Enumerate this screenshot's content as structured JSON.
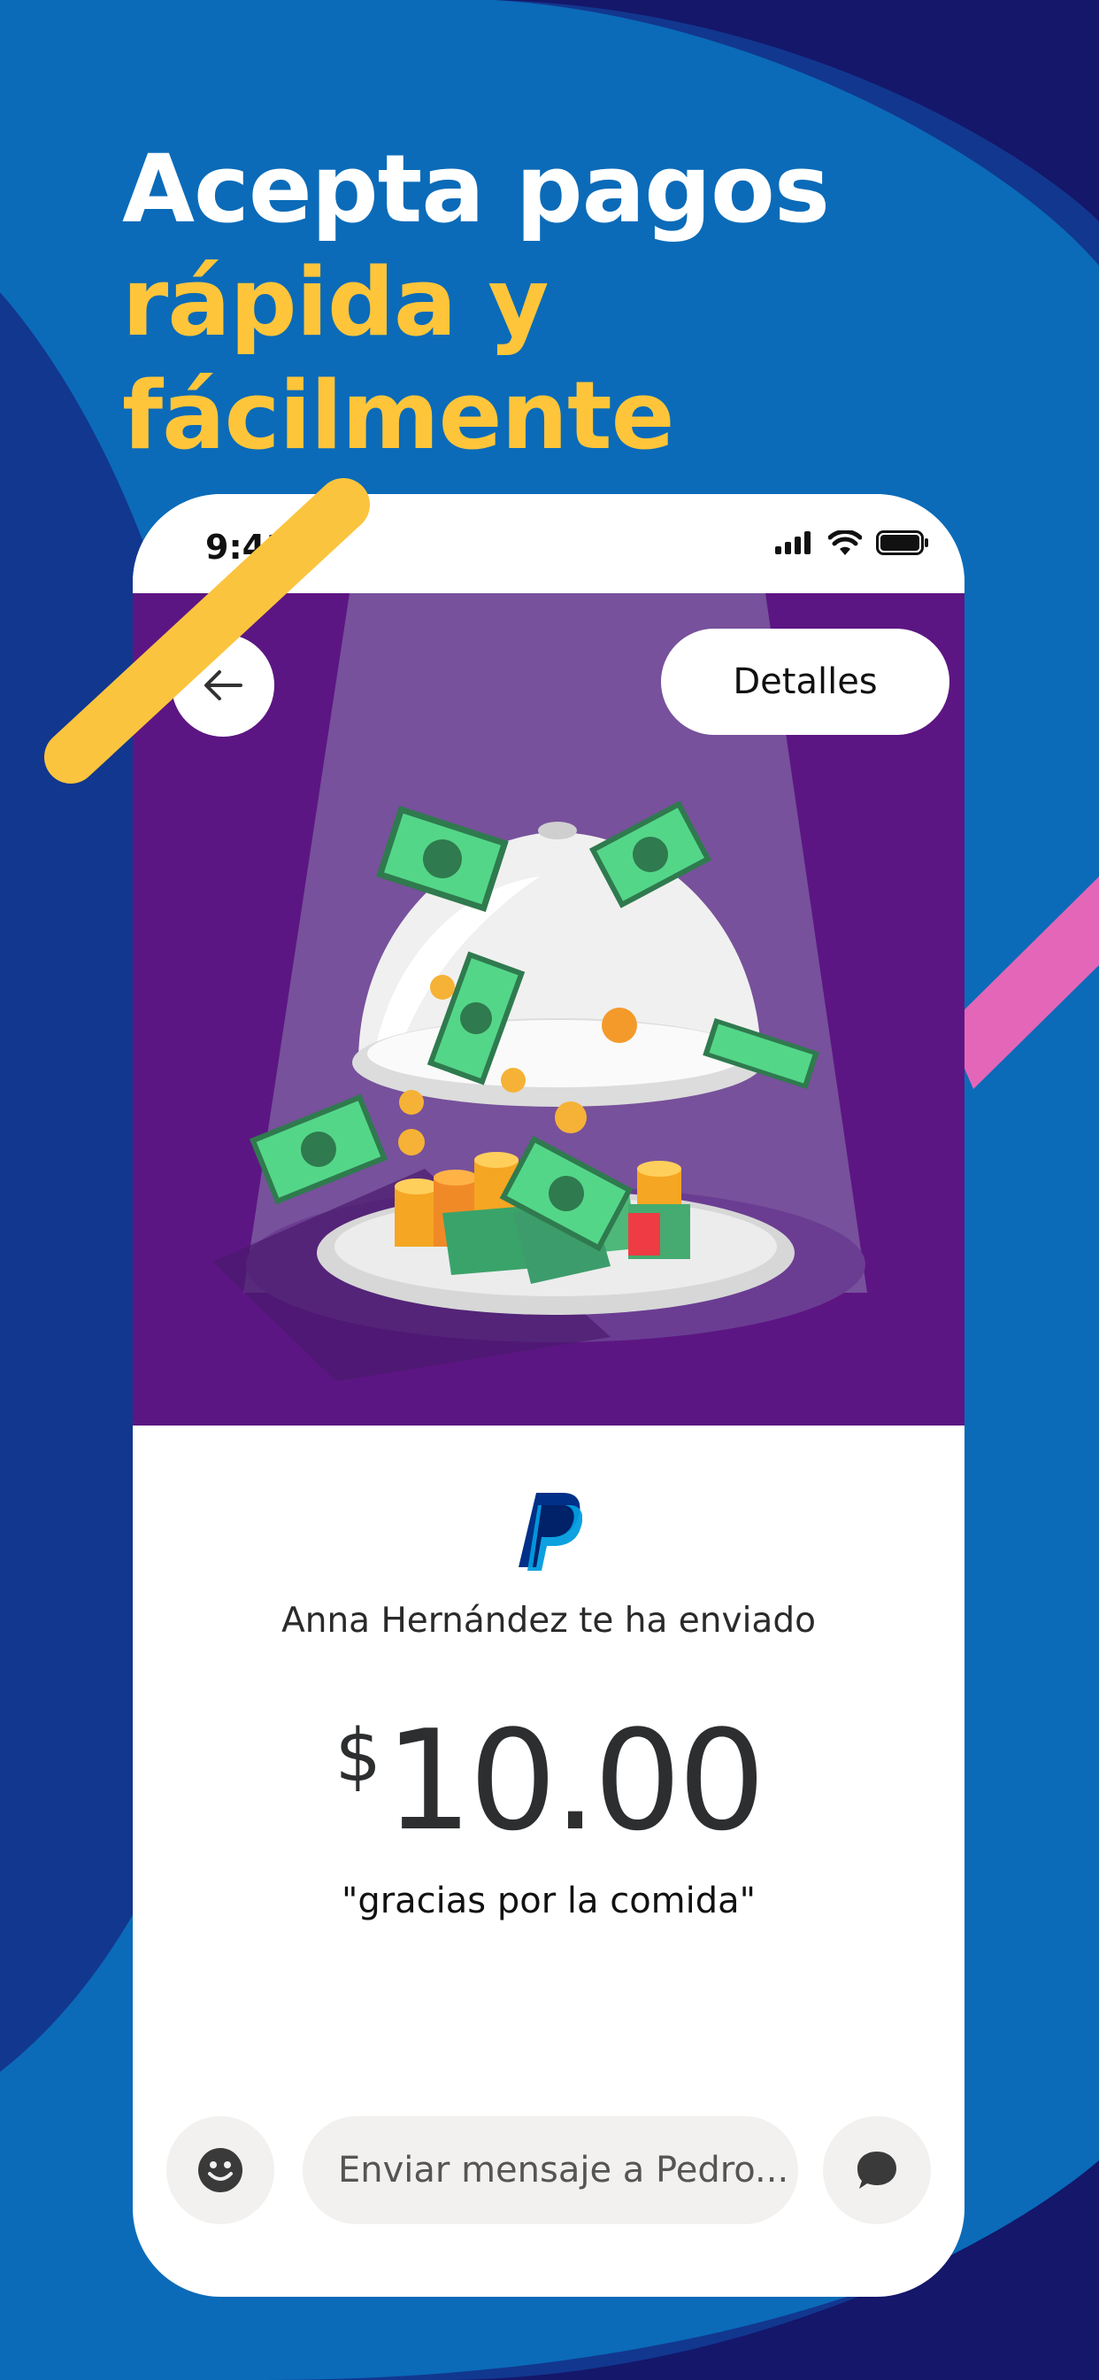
{
  "colors": {
    "background_dark": "#0d1e63",
    "background_blue": "#0b6bb8",
    "background_navy": "#12378f",
    "accent_yellow": "#ffc53a",
    "accent_pink": "#e466b8",
    "hero_purple": "#5c1683",
    "paypal_dark_blue": "#003087",
    "paypal_light_blue": "#009cde"
  },
  "headline": {
    "line1": "Acepta pagos",
    "line2": "rápida y fácilmente"
  },
  "phone": {
    "status_bar": {
      "time": "9:41",
      "icons": [
        "cellular-signal-icon",
        "wifi-icon",
        "battery-icon"
      ]
    },
    "back_button": {
      "icon": "arrow-left-icon"
    },
    "details_button": {
      "label": "Detalles"
    },
    "hero_illustration": "cloche-with-money",
    "payment": {
      "brand_icon": "paypal-logo-icon",
      "sender_text": "Anna Hernández te ha enviado",
      "currency_symbol": "$",
      "amount": "10.00",
      "note": "\"gracias por la comida\""
    },
    "composer": {
      "emoji_icon": "smiley-icon",
      "placeholder": "Enviar mensaje a Pedro...",
      "send_icon": "chat-bubble-icon"
    }
  }
}
